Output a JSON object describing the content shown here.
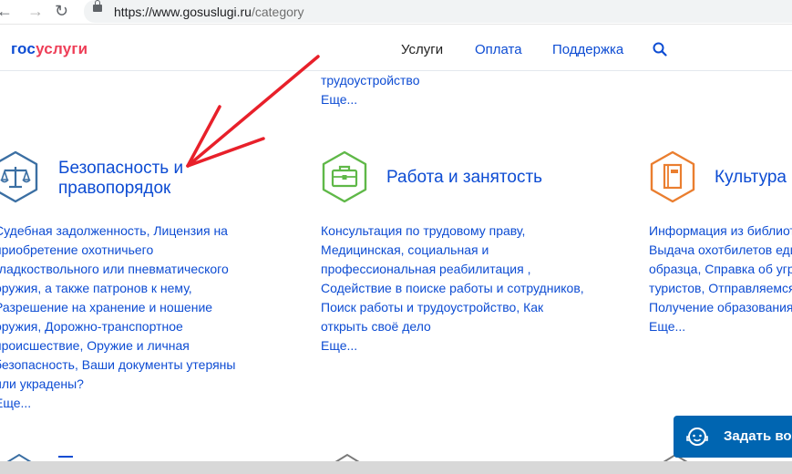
{
  "browser": {
    "url_host": "https://www.gosuslugi.ru",
    "url_path": "/category"
  },
  "site": {
    "logo_part1": "гос",
    "logo_part2": "услуги",
    "menu": [
      "Услуги",
      "Оплата",
      "Поддержка"
    ]
  },
  "top_continuation": {
    "text": "трудоустройство",
    "more": "Еще..."
  },
  "categories": [
    {
      "title_lines": [
        "Безопасность и",
        "правопорядок"
      ],
      "desc_lines": [
        "Судебная задолженность, Лицензия на",
        "приобретение охотничьего",
        "гладкоствольного или пневматического",
        "оружия, а также патронов к нему,",
        "Разрешение на хранение и ношение",
        "оружия, Дорожно-транспортное",
        "происшествие, Оружие и личная",
        "безопасность, Ваши документы утеряны",
        "или украдены?"
      ],
      "more": "Еще..."
    },
    {
      "title_lines": [
        "Работа и занятость"
      ],
      "desc_lines": [
        "Консультация по трудовому праву,",
        "Медицинская, социальная и",
        "профессиональная реабилитация ,",
        "Содействие в поиске работы и сотрудников,",
        "Поиск работы и трудоустройство, Как",
        "открыть своё дело"
      ],
      "more": "Еще..."
    },
    {
      "title_lines": [
        "Культура"
      ],
      "desc_lines": [
        "Информация из библиотечного фонда,",
        "Выдача охотбилетов единого федерального",
        "образца, Справка об угрозе безопасности",
        "туристов, Отправляемся в путешествие,",
        "Получение образования"
      ],
      "more": "Еще..."
    }
  ],
  "chat": {
    "label": "Задать вопрос"
  },
  "colors": {
    "link": "#0d4cd3",
    "logo_red": "#ee3f58",
    "icon_security": "#3b6fa3",
    "icon_work": "#5fb848",
    "icon_culture": "#ea7e2f",
    "chat_bg": "#0065b1",
    "annotation_arrow": "#e8202a"
  }
}
